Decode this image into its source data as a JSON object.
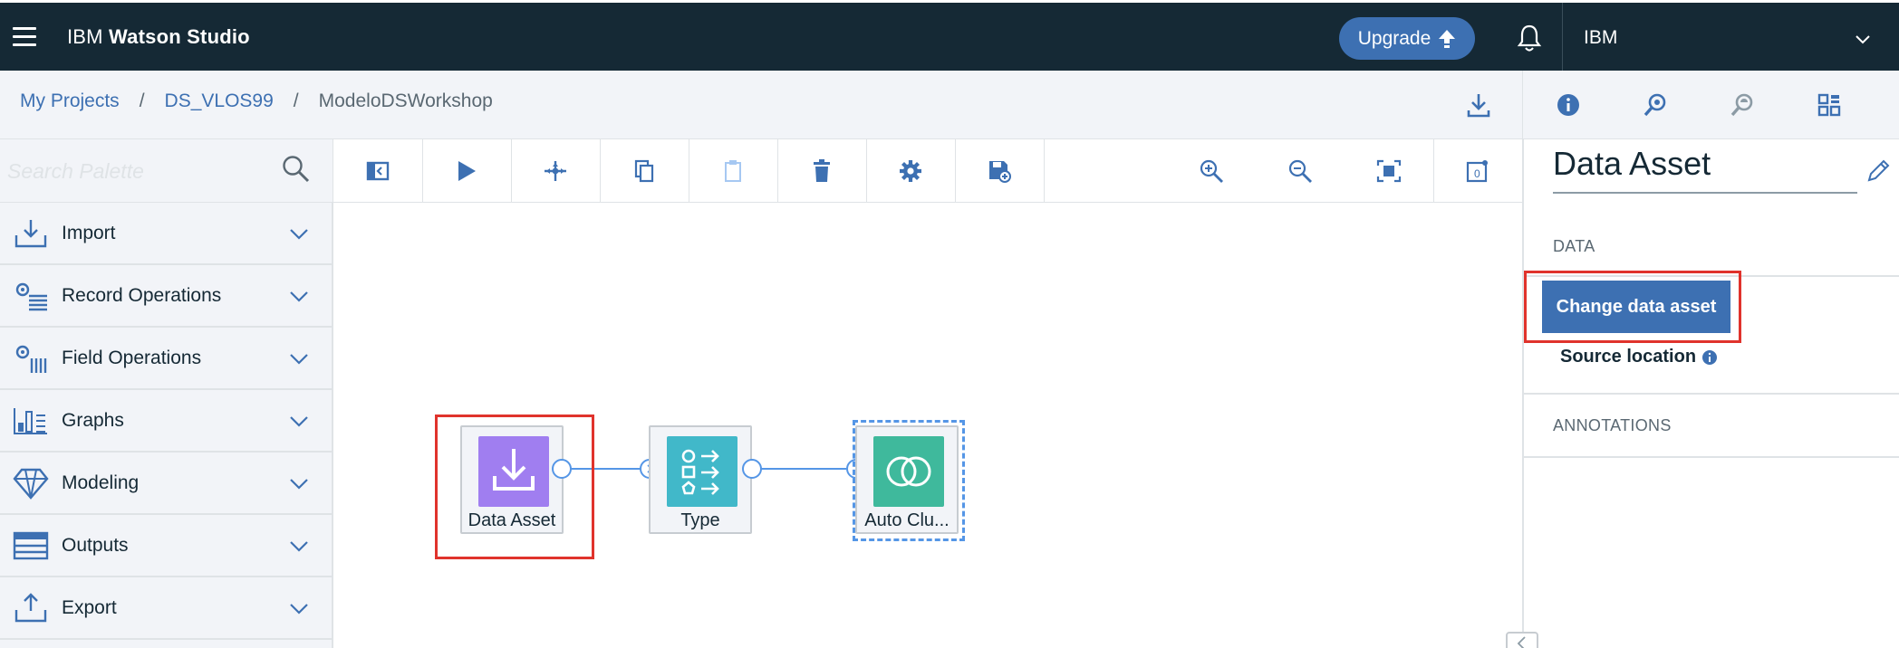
{
  "app": {
    "brand_prefix": "IBM",
    "brand_name": "Watson Studio",
    "upgrade_label": "Upgrade",
    "account_name": "IBM"
  },
  "breadcrumb": {
    "items": [
      "My Projects",
      "DS_VLOS99"
    ],
    "current": "ModeloDSWorkshop",
    "separator": "/"
  },
  "search": {
    "placeholder": "Search Palette",
    "value": ""
  },
  "toolbar": {
    "buttons": [
      "toggle-palette",
      "run",
      "auto-arrange",
      "copy",
      "paste",
      "delete",
      "settings",
      "save-as-model",
      "zoom-in",
      "zoom-out",
      "fit-to-screen",
      "comments"
    ]
  },
  "palette": {
    "items": [
      {
        "label": "Import",
        "icon": "import-icon"
      },
      {
        "label": "Record Operations",
        "icon": "record-operations-icon"
      },
      {
        "label": "Field Operations",
        "icon": "field-operations-icon"
      },
      {
        "label": "Graphs",
        "icon": "graphs-icon"
      },
      {
        "label": "Modeling",
        "icon": "modeling-icon"
      },
      {
        "label": "Outputs",
        "icon": "outputs-icon"
      },
      {
        "label": "Export",
        "icon": "export-icon"
      }
    ]
  },
  "canvas": {
    "nodes": [
      {
        "label": "Data Asset",
        "color": "#a07ef0"
      },
      {
        "label": "Type",
        "color": "#41b8c9"
      },
      {
        "label": "Auto Clu...",
        "color": "#3fb99c"
      }
    ]
  },
  "properties": {
    "title": "Data Asset",
    "data_section_label": "DATA",
    "change_button_label": "Change data asset",
    "source_location_label": "Source location",
    "annotations_label": "ANNOTATIONS"
  },
  "colors": {
    "topbar": "#152935",
    "accent": "#3d70b2",
    "highlight": "#e0332c",
    "link": "#5596e6"
  }
}
